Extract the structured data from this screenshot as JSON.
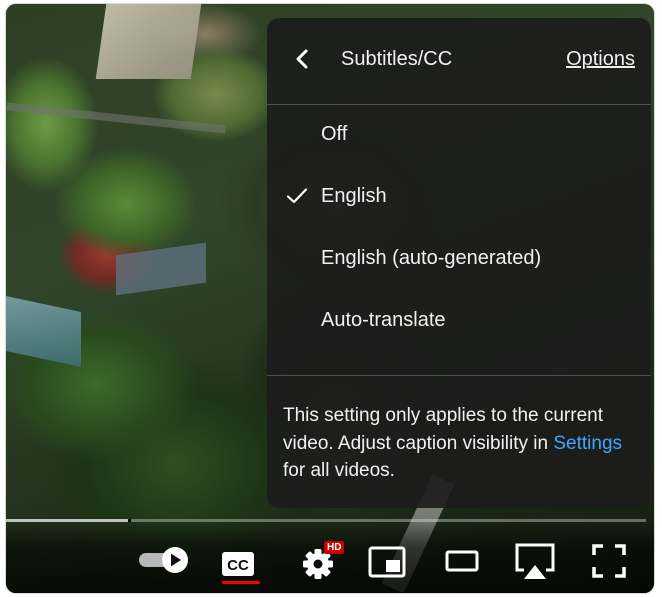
{
  "panel": {
    "title": "Subtitles/CC",
    "options_label": "Options",
    "items": [
      {
        "label": "Off",
        "selected": false
      },
      {
        "label": "English",
        "selected": true
      },
      {
        "label": "English (auto-generated)",
        "selected": false
      },
      {
        "label": "Auto-translate",
        "selected": false
      }
    ],
    "note_before": "This setting only applies to the current video. Adjust caption visibility in ",
    "note_link": "Settings",
    "note_after": " for all videos."
  },
  "controls": {
    "hd_badge": "HD",
    "cc_label": "CC",
    "progress_fraction": 0.19,
    "accent_color": "#ff0000",
    "link_color": "#3ea6ff",
    "icons": [
      "autoplay-toggle-icon",
      "cc-icon",
      "gear-icon",
      "miniplayer-icon",
      "theater-mode-icon",
      "airplay-icon",
      "fullscreen-icon"
    ]
  }
}
